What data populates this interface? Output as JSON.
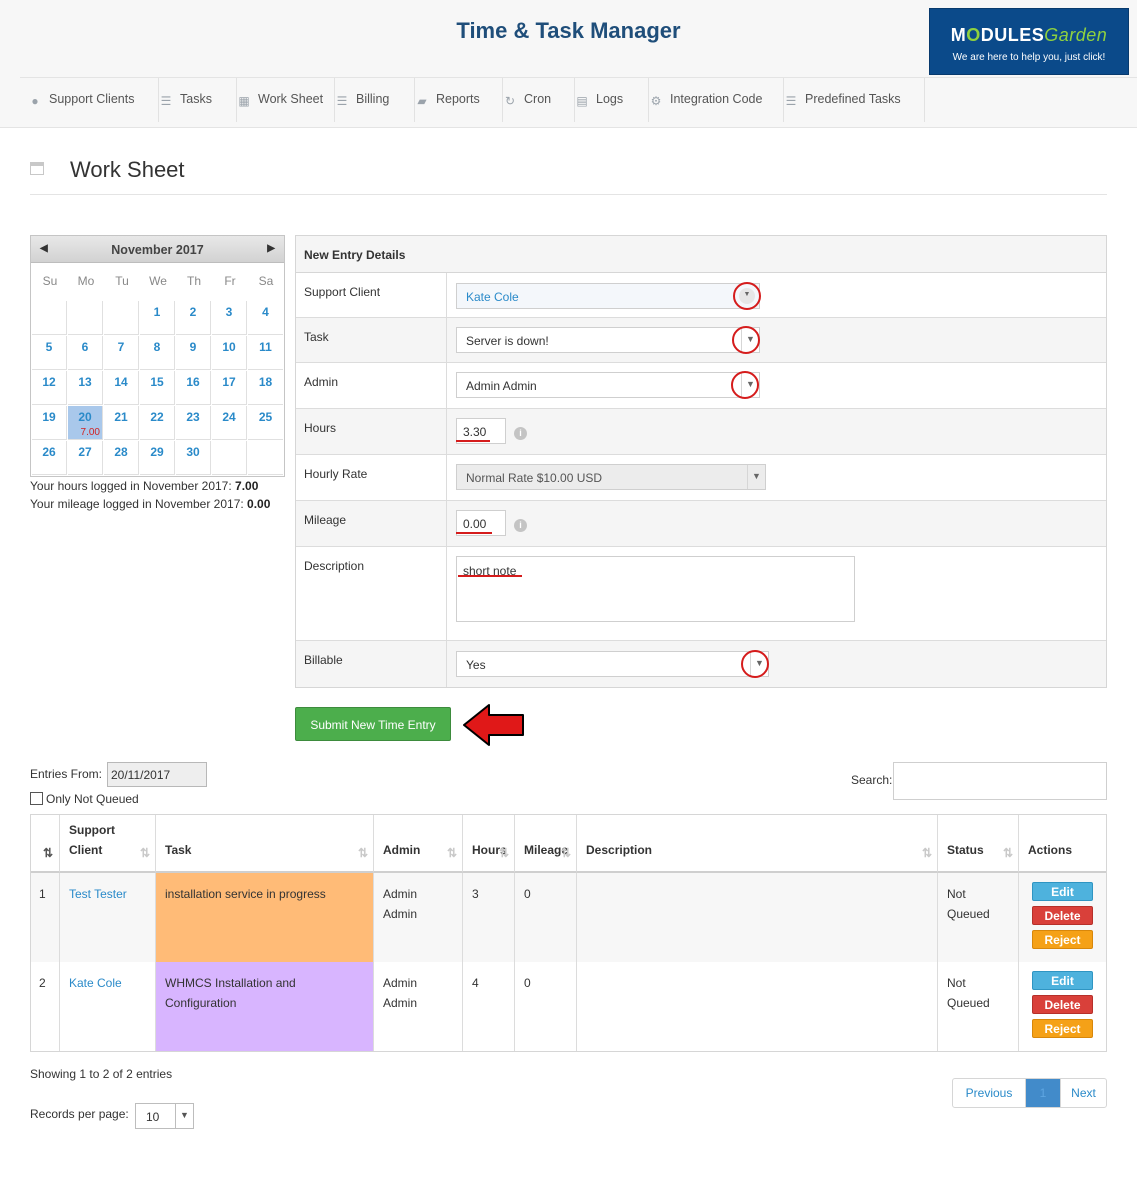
{
  "app": {
    "title": "Time & Task Manager"
  },
  "logo": {
    "name_pre": "M",
    "name_o": "O",
    "name_mid": "DULES",
    "name_light": "Garden",
    "tagline": "We are here to help you, just click!"
  },
  "nav": {
    "items": [
      {
        "label": "Support Clients",
        "icon": "user-icon"
      },
      {
        "label": "Tasks",
        "icon": "list-icon"
      },
      {
        "label": "Work Sheet",
        "icon": "calendar-icon"
      },
      {
        "label": "Billing",
        "icon": "list-icon"
      },
      {
        "label": "Reports",
        "icon": "book-icon"
      },
      {
        "label": "Cron",
        "icon": "refresh-icon"
      },
      {
        "label": "Logs",
        "icon": "table-icon"
      },
      {
        "label": "Integration Code",
        "icon": "gears-icon"
      },
      {
        "label": "Predefined Tasks",
        "icon": "list-icon"
      }
    ]
  },
  "page": {
    "title": "Work Sheet"
  },
  "calendar": {
    "month": "November 2017",
    "prev": "◀",
    "next": "▶",
    "weekdays": [
      "Su",
      "Mo",
      "Tu",
      "We",
      "Th",
      "Fr",
      "Sa"
    ],
    "weeks": [
      [
        "",
        "",
        "",
        "1",
        "2",
        "3",
        "4"
      ],
      [
        "5",
        "6",
        "7",
        "8",
        "9",
        "10",
        "11"
      ],
      [
        "12",
        "13",
        "14",
        "15",
        "16",
        "17",
        "18"
      ],
      [
        "19",
        "20",
        "21",
        "22",
        "23",
        "24",
        "25"
      ],
      [
        "26",
        "27",
        "28",
        "29",
        "30",
        "",
        ""
      ]
    ],
    "today": "20",
    "today_hours": "7.00",
    "hours_note": "Your hours logged in November 2017:",
    "hours_value": "7.00",
    "mileage_note": "Your mileage logged in November 2017:",
    "mileage_value": "0.00"
  },
  "form": {
    "heading": "New Entry Details",
    "support_client": {
      "label": "Support Client",
      "value": "Kate Cole"
    },
    "task": {
      "label": "Task",
      "value": "Server is down!"
    },
    "admin": {
      "label": "Admin",
      "value": "Admin Admin"
    },
    "hours": {
      "label": "Hours",
      "value": "3.30"
    },
    "hourly_rate": {
      "label": "Hourly Rate",
      "value": "Normal Rate $10.00 USD"
    },
    "mileage": {
      "label": "Mileage",
      "value": "0.00"
    },
    "description": {
      "label": "Description",
      "value": "short note"
    },
    "billable": {
      "label": "Billable",
      "value": "Yes"
    },
    "info_glyph": "i",
    "caret_glyph": "▼",
    "submit_label": "Submit New Time Entry"
  },
  "filters": {
    "entries_from_label": "Entries From:",
    "entries_from_value": "20/11/2017",
    "only_not_queued_label": "Only Not Queued",
    "search_label": "Search:"
  },
  "table": {
    "columns": {
      "support_client": "Support Client",
      "task": "Task",
      "admin": "Admin",
      "hours": "Hours",
      "mileage": "Mileage",
      "description": "Description",
      "status": "Status",
      "actions": "Actions"
    },
    "rows": [
      {
        "num": "1",
        "client": "Test Tester",
        "task": "installation service in progress",
        "task_color": "#ffbb77",
        "admin": "Admin Admin",
        "hours": "3",
        "mileage": "0",
        "description": "",
        "status": "Not Queued"
      },
      {
        "num": "2",
        "client": "Kate Cole",
        "task": "WHMCS Installation and Configuration",
        "task_color": "#d8b5ff",
        "admin": "Admin Admin",
        "hours": "4",
        "mileage": "0",
        "description": "",
        "status": "Not Queued"
      }
    ],
    "actions": {
      "edit": "Edit",
      "delete": "Delete",
      "reject": "Reject"
    }
  },
  "footer": {
    "showing": "Showing 1 to 2 of 2 entries",
    "pager": {
      "previous": "Previous",
      "current": "1",
      "next": "Next"
    },
    "records_label": "Records per page:",
    "records_value": "10"
  },
  "colors": {
    "accent": "#2a8ac9",
    "title": "#1f4e7a",
    "submit": "#4cae4c",
    "annotation_red": "#d51c1c"
  }
}
